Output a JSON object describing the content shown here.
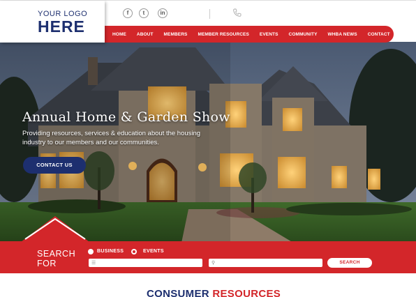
{
  "logo": {
    "line1": "YOUR LOGO",
    "line2": "HERE"
  },
  "social": [
    {
      "icon": "facebook-icon",
      "glyph": "f"
    },
    {
      "icon": "twitter-icon",
      "glyph": "t"
    },
    {
      "icon": "linkedin-icon",
      "glyph": "in"
    }
  ],
  "nav": {
    "items": [
      "HOME",
      "ABOUT",
      "MEMBERS",
      "MEMBER RESOURCES",
      "EVENTS",
      "COMMUNITY",
      "WHBA NEWS",
      "CONTACT"
    ]
  },
  "hero": {
    "title": "Annual Home & Garden Show",
    "subtitle": "Providing resources, services & education about the housing industry to our members and our communities.",
    "cta": "CONTACT US"
  },
  "search": {
    "label_line1": "SEARCH",
    "label_line2": "FOR",
    "option1": "BUSINESS",
    "option2": "EVENTS",
    "button": "SEARCH"
  },
  "section": {
    "title_part1": "CONSUMER ",
    "title_part2": "RESOURCES"
  },
  "colors": {
    "brand_red": "#d3262a",
    "brand_navy": "#1d2f6f"
  }
}
